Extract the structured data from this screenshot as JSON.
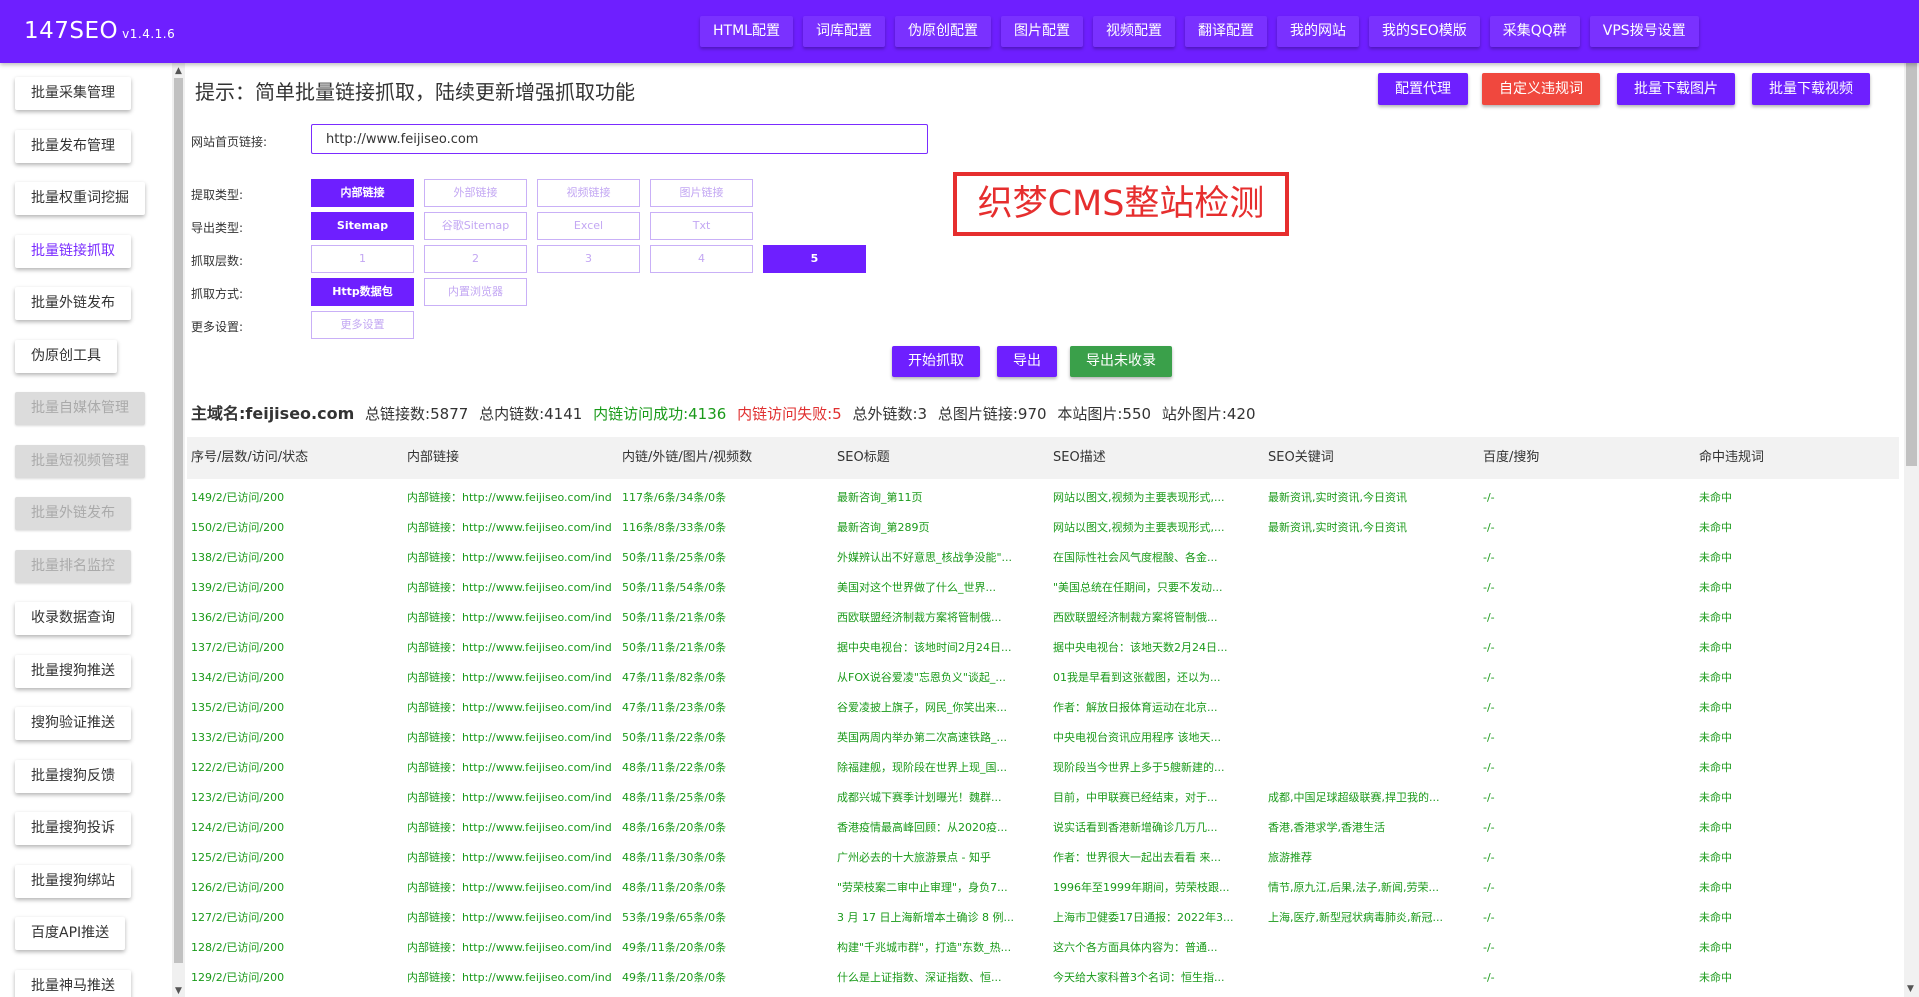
{
  "app": {
    "name": "147SEO",
    "version": "v1.4.1.6"
  },
  "nav": [
    "HTML配置",
    "词库配置",
    "伪原创配置",
    "图片配置",
    "视频配置",
    "翻译配置",
    "我的网站",
    "我的SEO模版",
    "采集QQ群",
    "VPS拨号设置"
  ],
  "sidebar": [
    {
      "label": "批量采集管理",
      "state": "normal"
    },
    {
      "label": "批量发布管理",
      "state": "normal"
    },
    {
      "label": "批量权重词挖掘",
      "state": "normal"
    },
    {
      "label": "批量链接抓取",
      "state": "active"
    },
    {
      "label": "批量外链发布",
      "state": "normal"
    },
    {
      "label": "伪原创工具",
      "state": "normal"
    },
    {
      "label": "批量自媒体管理",
      "state": "disabled"
    },
    {
      "label": "批量短视频管理",
      "state": "disabled"
    },
    {
      "label": "批量外链发布",
      "state": "disabled"
    },
    {
      "label": "批量排名监控",
      "state": "disabled"
    },
    {
      "label": "收录数据查询",
      "state": "normal"
    },
    {
      "label": "批量搜狗推送",
      "state": "normal"
    },
    {
      "label": "搜狗验证推送",
      "state": "normal"
    },
    {
      "label": "批量搜狗反馈",
      "state": "normal"
    },
    {
      "label": "批量搜狗投诉",
      "state": "normal"
    },
    {
      "label": "批量搜狗绑站",
      "state": "normal"
    },
    {
      "label": "百度API推送",
      "state": "normal"
    },
    {
      "label": "批量神马推送",
      "state": "normal"
    }
  ],
  "tip": "提示：简单批量链接抓取，陆续更新增强抓取功能",
  "top_buttons": [
    {
      "label": "配置代理",
      "color": "#6e1fff"
    },
    {
      "label": "自定义违规词",
      "color": "#f0483e"
    },
    {
      "label": "批量下载图片",
      "color": "#6e1fff"
    },
    {
      "label": "批量下载视频",
      "color": "#6e1fff"
    }
  ],
  "form": {
    "url_label": "网站首页链接:",
    "url_value": "http://www.feijiseo.com",
    "extract_label": "提取类型:",
    "extract_options": [
      "内部链接",
      "外部链接",
      "视频链接",
      "图片链接"
    ],
    "export_label": "导出类型:",
    "export_options": [
      "Sitemap",
      "谷歌Sitemap",
      "Excel",
      "Txt"
    ],
    "depth_label": "抓取层数:",
    "depth_options": [
      "1",
      "2",
      "3",
      "4",
      "5"
    ],
    "method_label": "抓取方式:",
    "method_options": [
      "Http数据包",
      "内置浏览器"
    ],
    "more_label": "更多设置:",
    "more_option": "更多设置"
  },
  "selected": {
    "extract": 0,
    "export": 0,
    "depth": 4,
    "method": 0
  },
  "overlay_text": "织梦CMS整站检测",
  "actions": [
    {
      "label": "开始抓取",
      "color": "#6e1fff"
    },
    {
      "label": "导出",
      "color": "#6e1fff"
    },
    {
      "label": "导出未收录",
      "color": "#3aa04a"
    }
  ],
  "stats": {
    "domain": "主域名:feijiseo.com",
    "total_links": "总链接数:5877",
    "internal": "总内链数:4141",
    "ok": "内链访问成功:4136",
    "fail": "内链访问失败:5",
    "external": "总外链数:3",
    "images": "总图片链接:970",
    "local_images": "本站图片:550",
    "outer_images": "站外图片:420"
  },
  "table": {
    "headers": [
      "序号/层数/访问/状态",
      "内部链接",
      "内链/外链/图片/视频数",
      "SEO标题",
      "SEO描述",
      "SEO关键词",
      "百度/搜狗",
      "命中违规词"
    ],
    "rows": [
      [
        "149/2/已访问/200",
        "内部链接：http://www.feijiseo.com/inde",
        "117条/6条/34条/0条",
        "最新咨询_第11页",
        "网站以图文,视频为主要表现形式,...",
        "最新资讯,实时资讯,今日资讯",
        "-/-",
        "未命中"
      ],
      [
        "150/2/已访问/200",
        "内部链接：http://www.feijiseo.com/inde",
        "116条/8条/33条/0条",
        "最新咨询_第289页",
        "网站以图文,视频为主要表现形式,...",
        "最新资讯,实时资讯,今日资讯",
        "-/-",
        "未命中"
      ],
      [
        "138/2/已访问/200",
        "内部链接：http://www.feijiseo.com/inde",
        "50条/11条/25条/0条",
        "外媒辨认出不好意思_核战争没能\"...",
        "在国际性社会风气度棍酸、各金...",
        "",
        "-/-",
        "未命中"
      ],
      [
        "139/2/已访问/200",
        "内部链接：http://www.feijiseo.com/inde",
        "50条/11条/54条/0条",
        "美国对这个世界做了什么_世界...",
        "\"美国总统在任期间，只要不发动...",
        "",
        "-/-",
        "未命中"
      ],
      [
        "136/2/已访问/200",
        "内部链接：http://www.feijiseo.com/inde",
        "50条/11条/21条/0条",
        "西欧联盟经济制裁方案将管制俄...",
        "西欧联盟经济制裁方案将管制俄...",
        "",
        "-/-",
        "未命中"
      ],
      [
        "137/2/已访问/200",
        "内部链接：http://www.feijiseo.com/inde",
        "50条/11条/21条/0条",
        "据中央电视台：该地时间2月24日...",
        "据中央电视台：该地天数2月24日...",
        "",
        "-/-",
        "未命中"
      ],
      [
        "134/2/已访问/200",
        "内部链接：http://www.feijiseo.com/inde",
        "47条/11条/82条/0条",
        "从FOX说谷爱凌\"忘恩负义\"谈起_...",
        "01我是早看到这张截图，还以为...",
        "",
        "-/-",
        "未命中"
      ],
      [
        "135/2/已访问/200",
        "内部链接：http://www.feijiseo.com/inde",
        "47条/11条/23条/0条",
        "谷爱凌披上旗子，网民_你笑出来...",
        "作者：解放日报体育运动在北京...",
        "",
        "-/-",
        "未命中"
      ],
      [
        "133/2/已访问/200",
        "内部链接：http://www.feijiseo.com/inde",
        "50条/11条/22条/0条",
        "英国两周内举办第二次高速铁路_...",
        "中央电视台资讯应用程序 该地天...",
        "",
        "-/-",
        "未命中"
      ],
      [
        "122/2/已访问/200",
        "内部链接：http://www.feijiseo.com/inde",
        "48条/11条/22条/0条",
        "除福建舰，现阶段在世界上现_国...",
        "现阶段当今世界上多于5艘新建的...",
        "",
        "-/-",
        "未命中"
      ],
      [
        "123/2/已访问/200",
        "内部链接：http://www.feijiseo.com/inde",
        "48条/11条/25条/0条",
        "成都兴城下赛季计划曝光！魏群...",
        "目前，中甲联赛已经结束，对于...",
        "成都,中国足球超级联赛,捍卫我的...",
        "-/-",
        "未命中"
      ],
      [
        "124/2/已访问/200",
        "内部链接：http://www.feijiseo.com/inde",
        "48条/16条/20条/0条",
        "香港疫情最高峰回顾：从2020疫...",
        "说实话看到香港新增确诊几万几...",
        "香港,香港求学,香港生活",
        "-/-",
        "未命中"
      ],
      [
        "125/2/已访问/200",
        "内部链接：http://www.feijiseo.com/inde",
        "48条/11条/30条/0条",
        "广州必去的十大旅游景点 - 知乎",
        "作者：世界很大一起出去看看 来...",
        "旅游推荐",
        "-/-",
        "未命中"
      ],
      [
        "126/2/已访问/200",
        "内部链接：http://www.feijiseo.com/inde",
        "48条/11条/20条/0条",
        "\"劳荣枝案二审中止审理\"，身负7...",
        "1996年至1999年期间，劳荣枝跟...",
        "情节,原九江,后果,法子,新闻,劳荣...",
        "-/-",
        "未命中"
      ],
      [
        "127/2/已访问/200",
        "内部链接：http://www.feijiseo.com/inde",
        "53条/19条/65条/0条",
        "3 月 17 日上海新增本土确诊 8 例...",
        "上海市卫健委17日通报：2022年3...",
        "上海,医疗,新型冠状病毒肺炎,新冠...",
        "-/-",
        "未命中"
      ],
      [
        "128/2/已访问/200",
        "内部链接：http://www.feijiseo.com/inde",
        "49条/11条/20条/0条",
        "构建\"千兆城市群\"，打造\"东数_热...",
        "这六个各方面具体内容为：普通...",
        "",
        "-/-",
        "未命中"
      ],
      [
        "129/2/已访问/200",
        "内部链接：http://www.feijiseo.com/inde",
        "49条/11条/20条/0条",
        "什么是上证指数、深证指数、恒...",
        "今天给大家科普3个名词：恒生指...",
        "",
        "-/-",
        "未命中"
      ]
    ]
  }
}
